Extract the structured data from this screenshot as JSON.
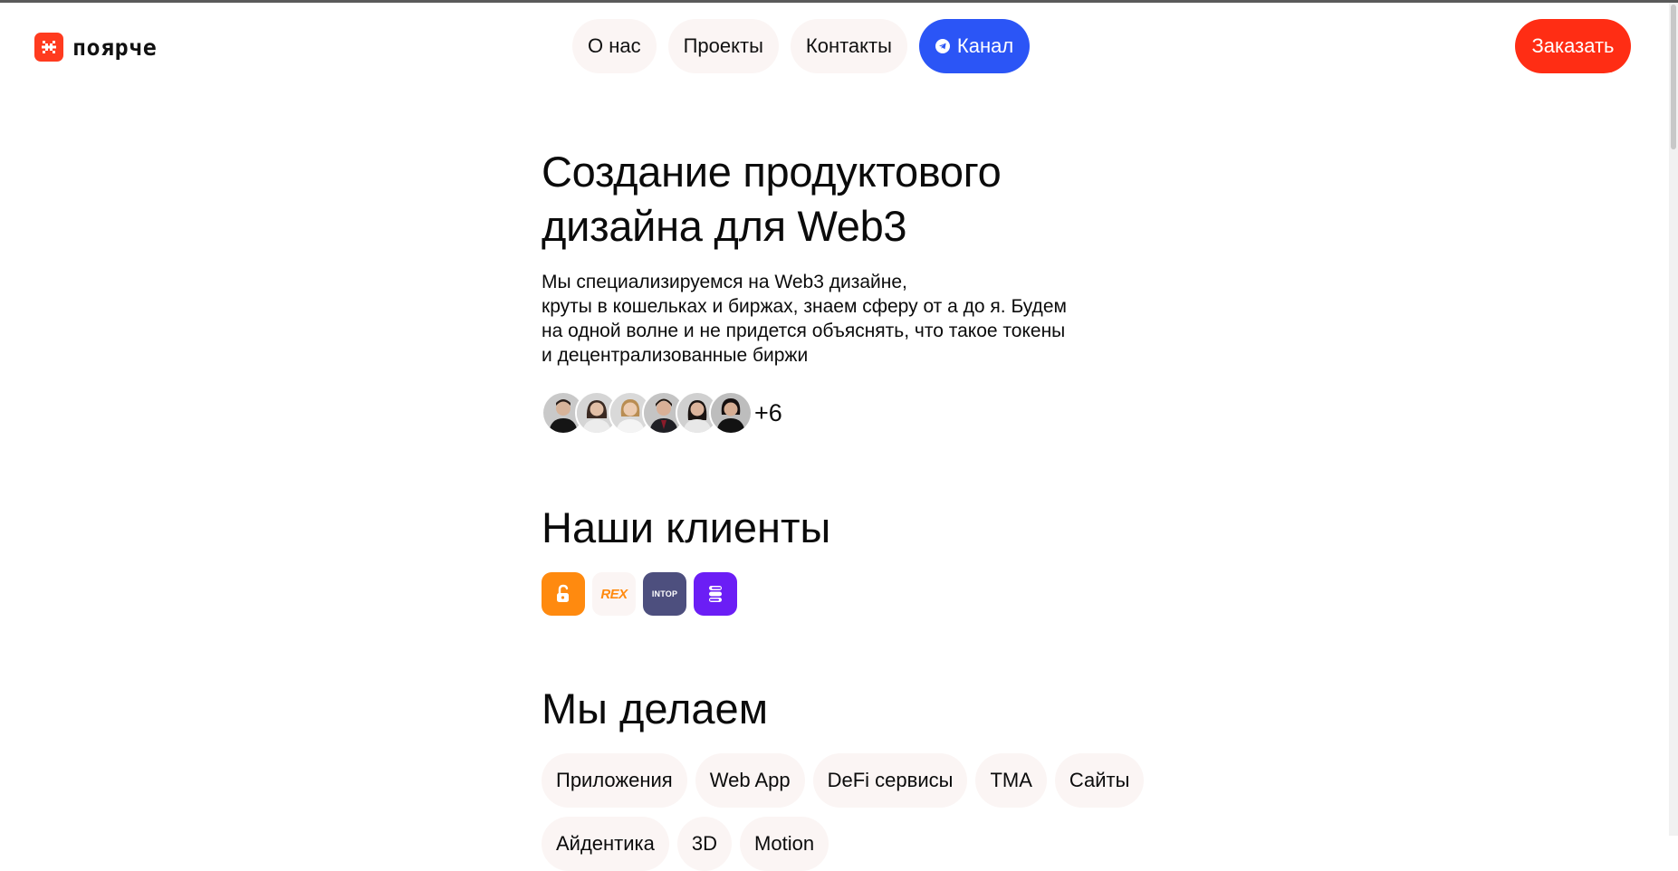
{
  "header": {
    "logo_text": "поярче",
    "nav": [
      {
        "label": "О нас"
      },
      {
        "label": "Проекты"
      },
      {
        "label": "Контакты"
      },
      {
        "label": "Канал"
      }
    ],
    "order_label": "Заказать"
  },
  "hero": {
    "title": "Создание продуктового дизайна для Web3",
    "description_lines": [
      "Мы специализируемся на Web3 дизайне,",
      "круты в кошельках и биржах, знаем сферу от а до я. Будем",
      "на одной волне и не придется объяснять, что такое токены",
      "и децентрализованные биржи"
    ],
    "team_extra": "+6"
  },
  "clients": {
    "title": "Наши клиенты",
    "logos": [
      {
        "icon": "unlock-icon"
      },
      {
        "label": "REX"
      },
      {
        "label": "INTOP"
      },
      {
        "icon": "s-logo-icon"
      }
    ]
  },
  "services": {
    "title": "Мы делаем",
    "chips": [
      "Приложения",
      "Web App",
      "DeFi сервисы",
      "TMA",
      "Сайты",
      "Айдентика",
      "3D",
      "Motion"
    ]
  },
  "colors": {
    "accent_red": "#ff2d14",
    "accent_blue": "#2b55f6",
    "pill_bg": "#fbf5f4"
  }
}
